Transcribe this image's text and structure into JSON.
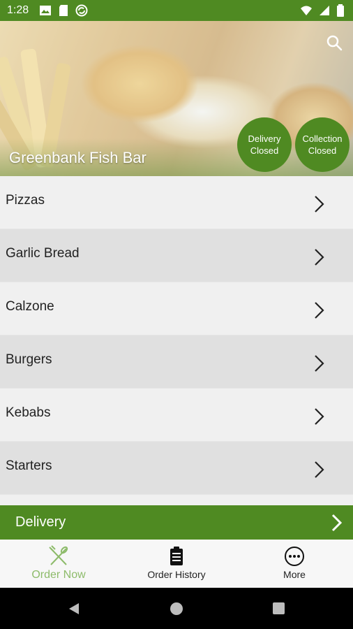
{
  "status_bar": {
    "time": "1:28",
    "left_icons": [
      "image-icon",
      "sd-card-icon",
      "sync-icon"
    ],
    "right_icons": [
      "wifi-icon",
      "signal-icon",
      "battery-icon"
    ],
    "color": "#4f8a22"
  },
  "hero": {
    "store_name": "Greenbank Fish Bar",
    "search_icon": "search-icon",
    "delivery_status": {
      "line1": "Delivery",
      "line2": "Closed"
    },
    "collection_status": {
      "line1": "Collection",
      "line2": "Closed"
    }
  },
  "categories": [
    {
      "label": "Pizzas"
    },
    {
      "label": "Garlic Bread"
    },
    {
      "label": "Calzone"
    },
    {
      "label": "Burgers"
    },
    {
      "label": "Kebabs"
    },
    {
      "label": "Starters"
    }
  ],
  "delivery_bar": {
    "label": "Delivery"
  },
  "bottom_nav": [
    {
      "label": "Order Now",
      "icon": "fork-knife-icon",
      "active": true
    },
    {
      "label": "Order History",
      "icon": "clipboard-icon",
      "active": false
    },
    {
      "label": "More",
      "icon": "more-icon",
      "active": false
    }
  ],
  "colors": {
    "brand_green": "#4f8a22",
    "active_nav": "#8dbb6a",
    "row_light": "#f0f0f0",
    "row_dark": "#e0e0e0"
  }
}
